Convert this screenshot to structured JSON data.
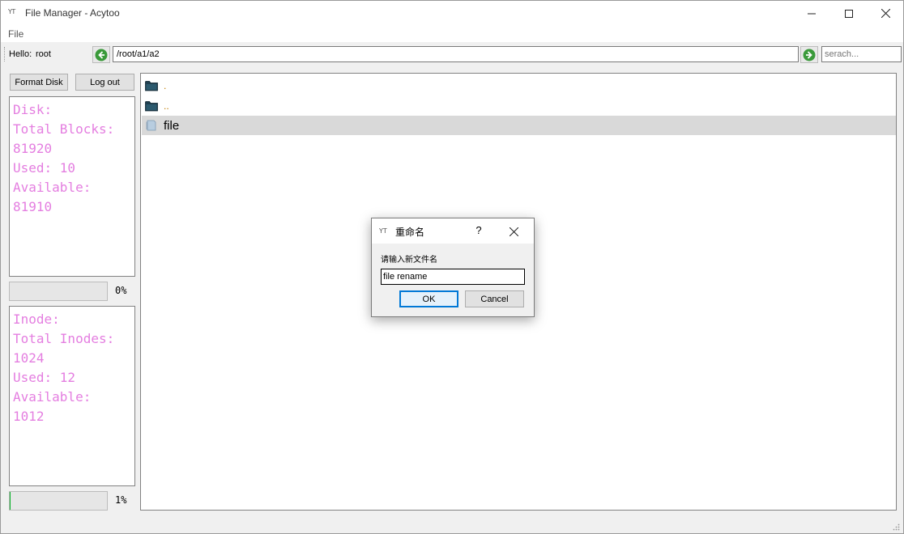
{
  "window": {
    "logo_text": "YT",
    "title": "File Manager - Acytoo"
  },
  "menu": {
    "file_label": "File"
  },
  "toolbar": {
    "hello_label": "Hello:",
    "username": "root",
    "path_value": "/root/a1/a2",
    "search_placeholder": "serach..."
  },
  "sidebar": {
    "format_label": "Format Disk",
    "logout_label": "Log out",
    "disk": {
      "lines": [
        "Disk:",
        "Total Blocks:",
        "81920",
        "Used: 10",
        "Available:",
        "81910"
      ],
      "percent_label": "0%",
      "progress": 0
    },
    "inode": {
      "lines": [
        "Inode:",
        "Total Inodes:",
        "1024",
        "Used: 12",
        "Available:",
        "1012"
      ],
      "percent_label": "1%",
      "progress": 0.01
    }
  },
  "files": [
    {
      "name": ".",
      "type": "folder",
      "selected": false
    },
    {
      "name": "..",
      "type": "folder",
      "selected": false
    },
    {
      "name": "file",
      "type": "file",
      "selected": true
    }
  ],
  "dialog": {
    "logo_text": "YT",
    "title": "重命名",
    "help_label": "?",
    "prompt": "请输入新文件名",
    "input_value": "file rename",
    "ok_label": "OK",
    "cancel_label": "Cancel"
  },
  "colors": {
    "info_text": "#e47ee0",
    "progress_fill": "#06b025",
    "selected_row": "#d9d9d9",
    "dialog_default_border": "#0078d7",
    "nav_green": "#3a9a3a"
  }
}
